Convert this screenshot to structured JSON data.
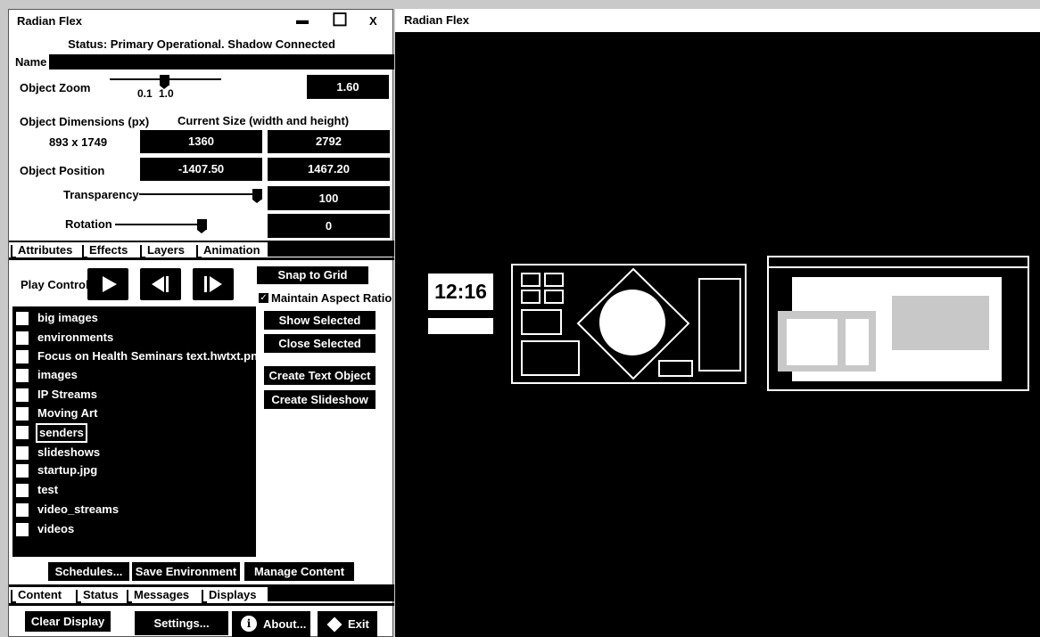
{
  "left_window": {
    "title": "Radian Flex",
    "minimize_glyph": "▬",
    "maximize_glyph": "☐",
    "close_label": "X",
    "status": "Status: Primary Operational. Shadow Connected",
    "name_label": "Name",
    "name_value": "",
    "zoom_label": "Object Zoom",
    "zoom_tick_1": "0.1",
    "zoom_tick_2": "1.0",
    "zoom_value": "1.60",
    "dimensions_label": "Object Dimensions (px)",
    "current_size_label": "Current Size (width and height)",
    "dimensions_value": "893 x 1749",
    "width_value": "1360",
    "height_value": "2792",
    "position_label": "Object Position",
    "pos_x": "-1407.50",
    "pos_y": "1467.20",
    "transparency_label": "Transparency",
    "transparency_value": "100",
    "rotation_label": "Rotation",
    "rotation_value": "0",
    "tabs_top": [
      "Attributes",
      "Effects",
      "Layers",
      "Animation"
    ],
    "play_control_label": "Play Control",
    "snap_label": "Snap to Grid",
    "maintain_label": "Maintain Aspect Ratio",
    "maintain_checked": "✓",
    "show_selected": "Show Selected",
    "close_selected": "Close Selected",
    "create_text": "Create Text Object",
    "create_slideshow": "Create Slideshow",
    "list_items": [
      "big images",
      "environments",
      "Focus on Health Seminars text.hwtxt.png",
      "images",
      "IP Streams",
      "Moving Art",
      "senders",
      "slideshows",
      "startup.jpg",
      "test",
      "video_streams",
      "videos"
    ],
    "selected_item": "senders",
    "schedules": "Schedules...",
    "save_env": "Save Environment",
    "manage_content": "Manage Content",
    "tabs_bottom": [
      "Content",
      "Status",
      "Messages",
      "Displays"
    ],
    "clear_display": "Clear Display",
    "settings": "Settings...",
    "about": "About...",
    "exit": "Exit"
  },
  "right_window": {
    "title": "Radian Flex",
    "clock": "12:16"
  },
  "colors": {
    "background": "#c9c9c9",
    "panel": "#ffffff",
    "dark": "#000000",
    "light_gray": "#c8c8c8"
  }
}
